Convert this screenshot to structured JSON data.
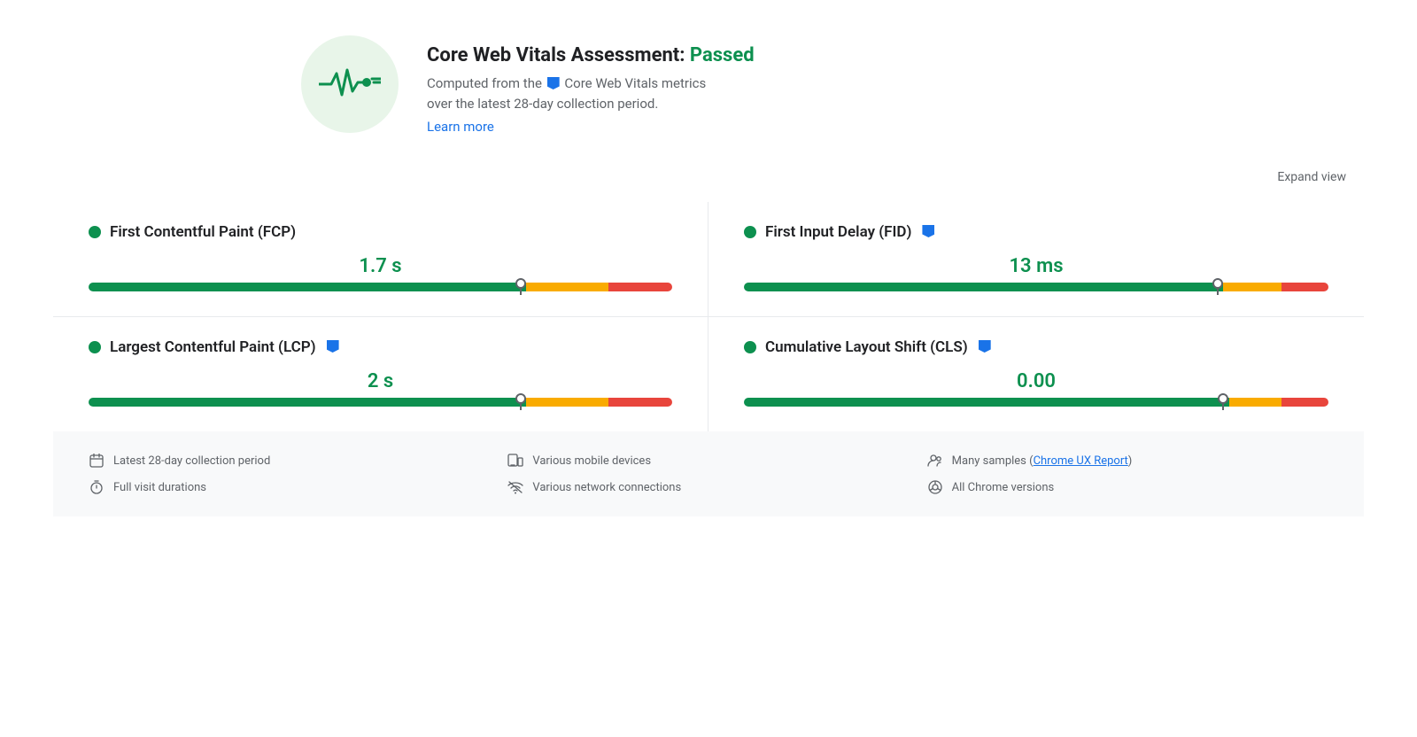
{
  "header": {
    "title_prefix": "Core Web Vitals Assessment: ",
    "title_status": "Passed",
    "description_part1": "Computed from the",
    "description_part2": "Core Web Vitals metrics",
    "description_part3": "over the latest 28-day collection period.",
    "learn_more_label": "Learn more"
  },
  "expand": {
    "label": "Expand view"
  },
  "metrics": [
    {
      "id": "fcp",
      "title": "First Contentful Paint (FCP)",
      "has_flag": false,
      "value": "1.7 s",
      "green_pct": 75,
      "orange_pct": 14,
      "red_pct": 11,
      "needle_pct": 74
    },
    {
      "id": "fid",
      "title": "First Input Delay (FID)",
      "has_flag": true,
      "value": "13 ms",
      "green_pct": 82,
      "orange_pct": 10,
      "red_pct": 8,
      "needle_pct": 81
    },
    {
      "id": "lcp",
      "title": "Largest Contentful Paint (LCP)",
      "has_flag": true,
      "value": "2 s",
      "green_pct": 75,
      "orange_pct": 14,
      "red_pct": 11,
      "needle_pct": 74
    },
    {
      "id": "cls",
      "title": "Cumulative Layout Shift (CLS)",
      "has_flag": true,
      "value": "0.00",
      "green_pct": 83,
      "orange_pct": 9,
      "red_pct": 8,
      "needle_pct": 82
    }
  ],
  "footer": {
    "items": [
      {
        "icon": "calendar-icon",
        "text": "Latest 28-day collection period",
        "link": null
      },
      {
        "icon": "devices-icon",
        "text": "Various mobile devices",
        "link": null
      },
      {
        "icon": "users-icon",
        "text": "Many samples (",
        "link": "Chrome UX Report",
        "text_after": ")",
        "link_null": false
      },
      {
        "icon": "timer-icon",
        "text": "Full visit durations",
        "link": null
      },
      {
        "icon": "wifi-icon",
        "text": "Various network connections",
        "link": null
      },
      {
        "icon": "chrome-icon",
        "text": "All Chrome versions",
        "link": null
      }
    ]
  }
}
